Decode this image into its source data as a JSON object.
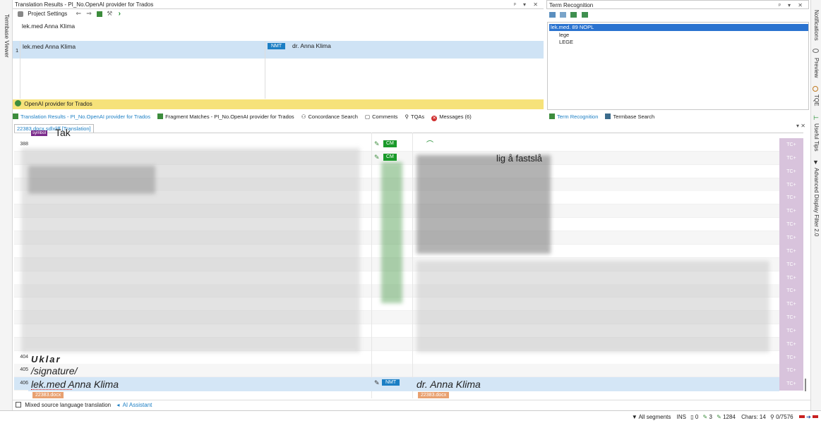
{
  "left_sidebar": {
    "termbase_viewer_label": "Termbase Viewer"
  },
  "right_sidebar": {
    "tabs": [
      "Notifications",
      "Preview",
      "TQE",
      "Useful Tips",
      "Advanced Display Filter 2.0"
    ]
  },
  "translation_results": {
    "title": "Translation Results - PI_No.OpenAI provider for Trados",
    "toolbar_project_settings": "Project Settings",
    "source_preview": "lek.med Anna Klima",
    "row_number": "1",
    "source_text": "lek.med Anna Klima",
    "match_badge": "NMT",
    "target_text": "dr. Anna Klima",
    "provider_bar": "OpenAI provider for Trados"
  },
  "term_recognition": {
    "title": "Term Recognition",
    "selected_term": "lek.med.  89    NOPL",
    "items": [
      "lege",
      "LEGE"
    ]
  },
  "tabs_left": [
    "Translation Results - PI_No.OpenAI provider for Trados",
    "Fragment Matches - PI_No.OpenAI provider for Trados",
    "Concordance Search",
    "Comments",
    "TQAs",
    "Messages (6)"
  ],
  "tabs_right": [
    "Term Recognition",
    "Termbase Search"
  ],
  "editor": {
    "doc_tab": "22383.docx.sdlxliff [Translation]",
    "symbol_tag": "symbol",
    "row387_source": "Tak",
    "row388_num": "388",
    "cm_label": "CM",
    "fragment_target": "lig å fastslå",
    "tc_label": "TC+",
    "row404_num": "404",
    "row404_source": "Uklar",
    "row405_num": "405",
    "row405_source": "/signature/",
    "row406_num": "406",
    "row406_source": "lek.med Anna Klima",
    "row406_badge": "NMT",
    "row406_target": "dr. Anna Klima",
    "file_tag": "22383.docx"
  },
  "bottom_tabs": [
    "Mixed source language translation",
    "AI Assistant"
  ],
  "status_bar": {
    "filter": "All segments",
    "mode": "INS",
    "count_a": "0",
    "count_b": "3",
    "count_c": "1284",
    "chars": "Chars: 14",
    "progress": "0/7576"
  },
  "colors": {
    "accent_blue": "#1c7fc4",
    "cm_green": "#1a9a2a",
    "tc_purple": "#d8c3dc",
    "provider_yellow": "#f6e27a",
    "selected_row": "#cfe3f5",
    "term_selected": "#2a73d0"
  }
}
